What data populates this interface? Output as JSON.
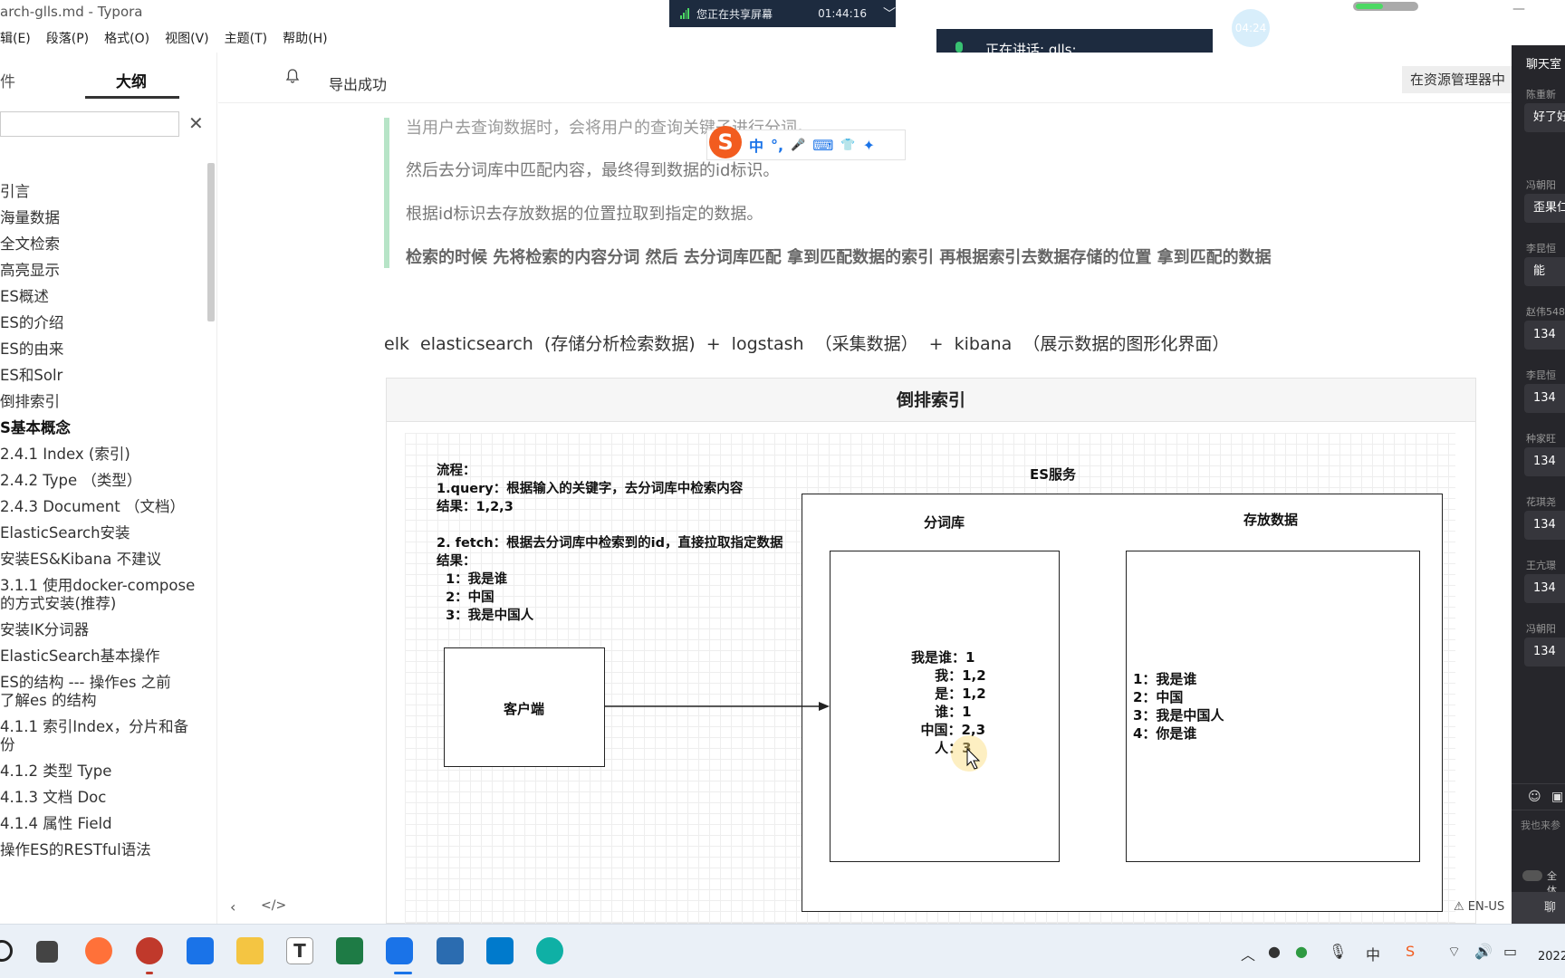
{
  "window": {
    "title": "arch-glls.md - Typora"
  },
  "menu": [
    "辑(E)",
    "段落(P)",
    "格式(O)",
    "视图(V)",
    "主题(T)",
    "帮助(H)"
  ],
  "share": {
    "label": "您正在共享屏幕",
    "time": "01:44:16"
  },
  "speaking": {
    "label": "正在讲话: glls;"
  },
  "timer_bubble": "04:24",
  "sidebar": {
    "tab_files": "件",
    "tab_outline": "大纲",
    "outline": [
      {
        "label": "引言",
        "bold": false
      },
      {
        "label": "海量数据",
        "bold": false
      },
      {
        "label": "全文检索",
        "bold": false
      },
      {
        "label": "高亮显示",
        "bold": false
      },
      {
        "label": "ES概述",
        "bold": false
      },
      {
        "label": "ES的介绍",
        "bold": false
      },
      {
        "label": "ES的由来",
        "bold": false
      },
      {
        "label": "ES和Solr",
        "bold": false
      },
      {
        "label": "倒排索引",
        "bold": false
      },
      {
        "label": "S基本概念",
        "bold": true
      },
      {
        "label": "2.4.1 Index (索引)",
        "bold": false
      },
      {
        "label": "2.4.2 Type （类型）",
        "bold": false
      },
      {
        "label": "2.4.3 Document （文档）",
        "bold": false
      },
      {
        "label": "ElasticSearch安装",
        "bold": false
      },
      {
        "label": "安装ES&Kibana 不建议",
        "bold": false
      },
      {
        "label": "3.1.1 使用docker-compose",
        "bold": false
      },
      {
        "label": "的方式安装(推荐)",
        "bold": false
      },
      {
        "label": "安装IK分词器",
        "bold": false
      },
      {
        "label": "ElasticSearch基本操作",
        "bold": false
      },
      {
        "label": "ES的结构 --- 操作es 之前",
        "bold": false
      },
      {
        "label": "了解es 的结构",
        "bold": false
      },
      {
        "label": "4.1.1 索引Index，分片和备",
        "bold": false
      },
      {
        "label": "份",
        "bold": false
      },
      {
        "label": "4.1.2 类型 Type",
        "bold": false
      },
      {
        "label": "4.1.3 文档 Doc",
        "bold": false
      },
      {
        "label": "4.1.4 属性 Field",
        "bold": false
      },
      {
        "label": "操作ES的RESTful语法",
        "bold": false
      }
    ]
  },
  "editor": {
    "notification": "导出成功",
    "explorer_button": "在资源管理器中",
    "quote_lines": [
      "当用户去查询数据时，会将用户的查询关键子进行分词。",
      "然后去分词库中匹配内容，最终得到数据的id标识。",
      "根据id标识去存放数据的位置拉取到指定的数据。"
    ],
    "quote_bold": "检索的时候  先将检索的内容分词   然后 去分词库匹配  拿到匹配数据的索引 再根据索引去数据存储的位置 拿到匹配的数据",
    "elk_line": "elk    elasticsearch (存储分析检索数据)  +  logstash （采集数据）   +  kibana （展示数据的图形化界面）"
  },
  "ime": {
    "chars": [
      "中",
      "°,",
      "🎤",
      "⌨",
      "👕",
      "✦"
    ]
  },
  "diagram": {
    "title": "倒排索引",
    "flow_text": "流程：\n1.query：根据输入的关键字，去分词库中检索内容\n结果：1,2,3\n\n2. fetch：根据去分词库中检索到的id，直接拉取指定数据\n结果：\n  1：我是谁\n  2：中国\n  3：我是中国人",
    "es_service": "ES服务",
    "client": "客户端",
    "dict_label": "分词库",
    "store_label": "存放数据",
    "dict_entries": "我是谁：1\n     我：1,2\n     是：1,2\n     谁：1\n  中国：2,3\n     人：3",
    "store_entries": "1：我是谁\n2：中国\n3：我是中国人\n4：你是谁"
  },
  "chat": {
    "header": "聊天室",
    "messages": [
      {
        "name": "陈重新",
        "text": "好了好"
      },
      {
        "name": "冯朝阳",
        "text": "歪果仁"
      },
      {
        "name": "李昆恒",
        "text": "能"
      },
      {
        "name": "赵伟548",
        "text": "134"
      },
      {
        "name": "李昆恒",
        "text": "134"
      },
      {
        "name": "种家旺",
        "text": "134"
      },
      {
        "name": "花琪尧",
        "text": "134"
      },
      {
        "name": "王亢璟",
        "text": "134"
      },
      {
        "name": "冯朝阳",
        "text": "134"
      }
    ],
    "input_placeholder": "我也来参",
    "toggle_label": "全体",
    "send_label": "聊天"
  },
  "status": {
    "lang": "EN-US"
  },
  "clock": "2022"
}
